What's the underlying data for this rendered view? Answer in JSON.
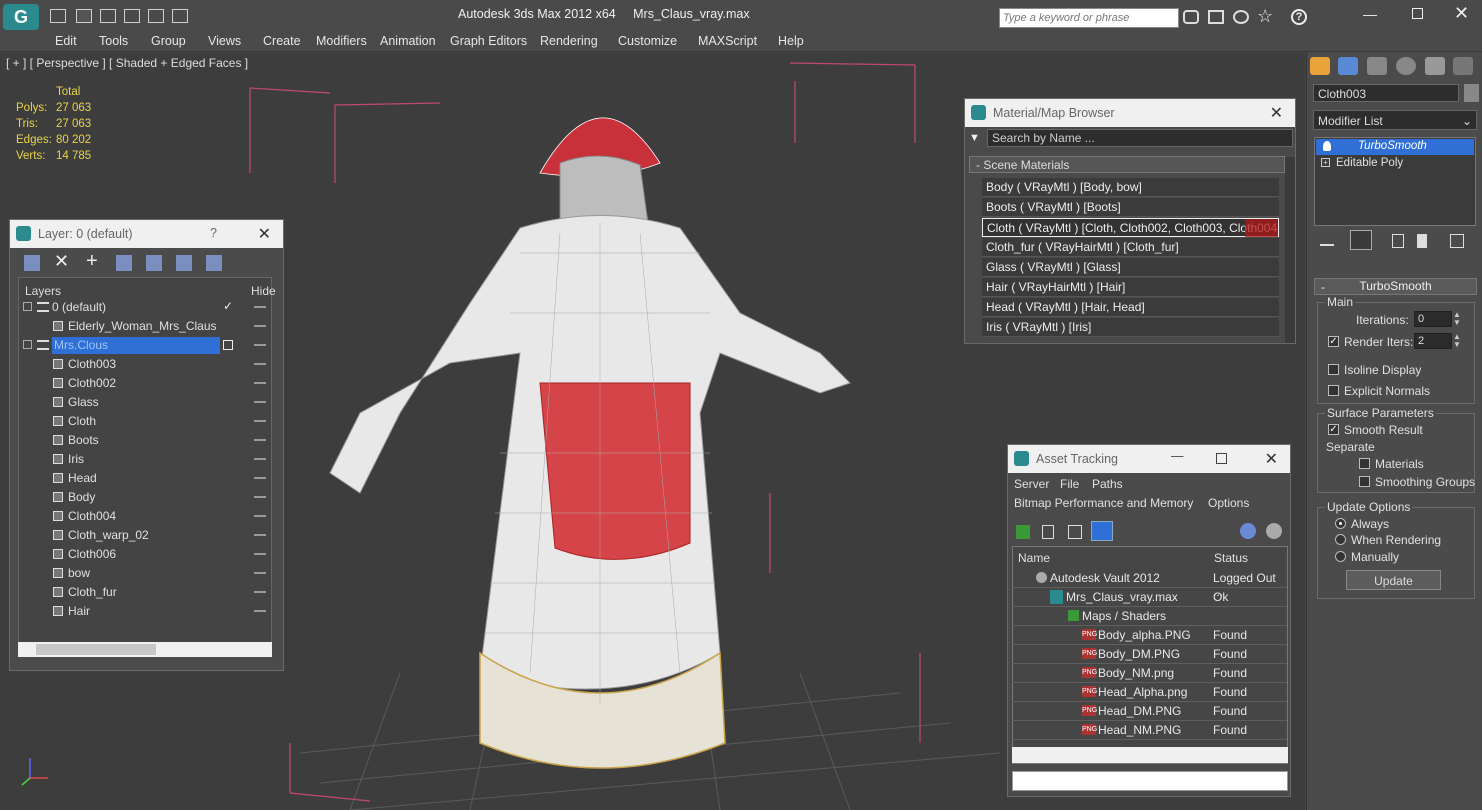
{
  "app": {
    "title": "Autodesk 3ds Max  2012 x64",
    "file": "Mrs_Claus_vray.max",
    "search_placeholder": "Type a keyword or phrase"
  },
  "menu": [
    "Edit",
    "Tools",
    "Group",
    "Views",
    "Create",
    "Modifiers",
    "Animation",
    "Graph Editors",
    "Rendering",
    "Customize",
    "MAXScript",
    "Help"
  ],
  "viewport": {
    "label": "[ + ] [ Perspective ] [ Shaded + Edged Faces ]",
    "stats_header": "Total",
    "stats": [
      {
        "k": "Polys:",
        "v": "27 063"
      },
      {
        "k": "Tris:",
        "v": "27 063"
      },
      {
        "k": "Edges:",
        "v": "80 202"
      },
      {
        "k": "Verts:",
        "v": "14 785"
      }
    ]
  },
  "layer_panel": {
    "title": "Layer: 0 (default)",
    "help": "?",
    "col_layers": "Layers",
    "col_hide": "Hide",
    "rows": [
      "0 (default)",
      "Elderly_Woman_Mrs_Claus",
      "Mrs.Clous",
      "Cloth003",
      "Cloth002",
      "Glass",
      "Cloth",
      "Boots",
      "Iris",
      "Head",
      "Body",
      "Cloth004",
      "Cloth_warp_02",
      "Cloth006",
      "bow",
      "Cloth_fur",
      "Hair"
    ]
  },
  "material_browser": {
    "title": "Material/Map Browser",
    "search_placeholder": "Search by Name ...",
    "section": "Scene Materials",
    "items": [
      "Body  ( VRayMtl ) [Body, bow]",
      "Boots  ( VRayMtl ) [Boots]",
      "Cloth  ( VRayMtl ) [Cloth, Cloth002, Cloth003, Cloth004...",
      "Cloth_fur  ( VRayHairMtl ) [Cloth_fur]",
      "Glass  ( VRayMtl ) [Glass]",
      "Hair  ( VRayHairMtl ) [Hair]",
      "Head  ( VRayMtl ) [Hair, Head]",
      "Iris  ( VRayMtl ) [Iris]"
    ]
  },
  "asset_tracking": {
    "title": "Asset Tracking",
    "menu1": [
      "Server",
      "File",
      "Paths"
    ],
    "menu2": [
      "Bitmap Performance and Memory",
      "Options"
    ],
    "col_name": "Name",
    "col_status": "Status",
    "rows": [
      {
        "name": "Autodesk Vault 2012",
        "status": "Logged Out ..."
      },
      {
        "name": "Mrs_Claus_vray.max",
        "status": "Ok"
      },
      {
        "name": "Maps / Shaders",
        "status": ""
      },
      {
        "name": "Body_alpha.PNG",
        "status": "Found"
      },
      {
        "name": "Body_DM.PNG",
        "status": "Found"
      },
      {
        "name": "Body_NM.png",
        "status": "Found"
      },
      {
        "name": "Head_Alpha.png",
        "status": "Found"
      },
      {
        "name": "Head_DM.PNG",
        "status": "Found"
      },
      {
        "name": "Head_NM.PNG",
        "status": "Found"
      }
    ]
  },
  "command_panel": {
    "object_name": "Cloth003",
    "modifier_list": "Modifier List",
    "stack": [
      "TurboSmooth",
      "Editable Poly"
    ],
    "rollout": "TurboSmooth",
    "main": "Main",
    "iterations_label": "Iterations:",
    "iterations": "0",
    "render_iters_label": "Render Iters:",
    "render_iters": "2",
    "isoline": "Isoline Display",
    "explicit": "Explicit Normals",
    "surface": "Surface Parameters",
    "smooth": "Smooth Result",
    "separate": "Separate",
    "materials": "Materials",
    "smoothing": "Smoothing Groups",
    "update_opts": "Update Options",
    "always": "Always",
    "when_rendering": "When Rendering",
    "manually": "Manually",
    "update_btn": "Update"
  },
  "colors": {
    "accent": "#2b8a8e",
    "selected": "#2f6fd6",
    "stats": "#e8d34a"
  }
}
